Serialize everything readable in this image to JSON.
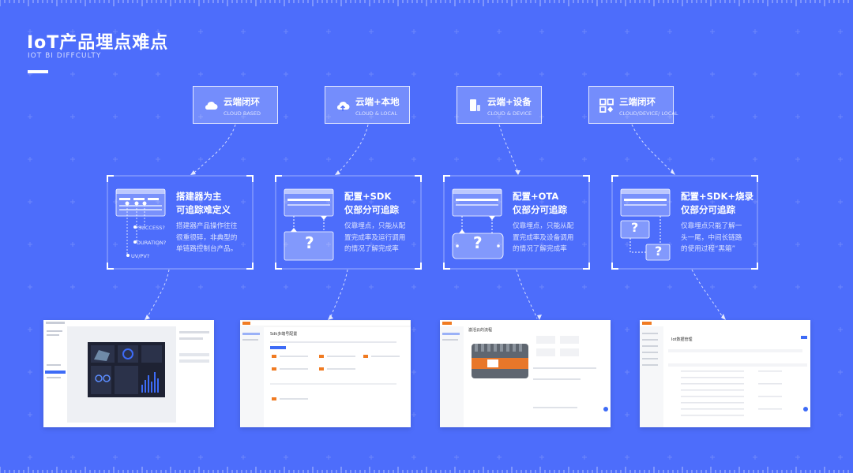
{
  "header": {
    "title": "IoT产品埋点难点",
    "subtitle": "IOT BI DIFFCULTY"
  },
  "categories": [
    {
      "cn": "云端闭环",
      "en": "CLOUD BASED",
      "icon": "cloud-icon"
    },
    {
      "cn": "云端+本地",
      "en": "CLOUD & LOCAL",
      "icon": "cloud-upload-icon"
    },
    {
      "cn": "云端+设备",
      "en": "CLOUD & DEVICE",
      "icon": "device-icon"
    },
    {
      "cn": "三端闭环",
      "en": "CLOUD/DEVICE/ LOCAL",
      "icon": "apps-icon"
    }
  ],
  "cards": [
    {
      "h1": "搭建器为主",
      "h2": "可追踪难定义",
      "desc": [
        "搭建器产品操作往往",
        "很重很碎，非典型的",
        "单链路控制台产品。"
      ],
      "labels": [
        "SUCCESS?",
        "DURATION?",
        "UV/PV?"
      ]
    },
    {
      "h1": "配置+SDK",
      "h2": "仅部分可追踪",
      "desc": [
        "仅靠埋点，只能从配",
        "置完成率及运行调用",
        "的情况了解完成率"
      ],
      "mark": "?"
    },
    {
      "h1": "配置+OTA",
      "h2": "仅部分可追踪",
      "desc": [
        "仅靠埋点，只能从配",
        "置完成率及设备调用",
        "的情况了解完成率"
      ],
      "mark": "?"
    },
    {
      "h1": "配置+SDK+烧录",
      "h2": "仅部分可追踪",
      "desc": [
        "仅靠埋点只能了解一",
        "头一尾，中间长链路",
        "的使用过程“黑箱”"
      ],
      "mark": "?"
    }
  ],
  "screens": {
    "s2_heading": "Sdk多端号配置",
    "s3_heading": "激活云的流程",
    "s4_heading": "Iot数据管理"
  },
  "colors": {
    "background": "#4d6dfb",
    "accent_orange": "#f07b22",
    "dark_panel": "#1e2233"
  }
}
